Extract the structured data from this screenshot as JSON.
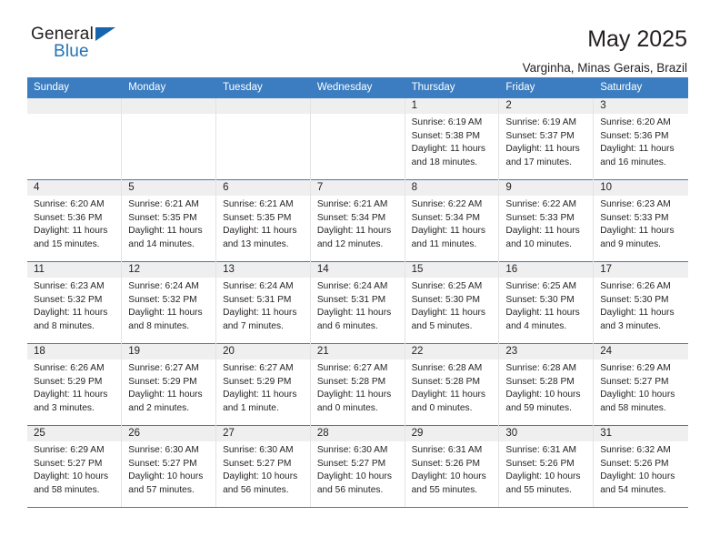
{
  "brand": {
    "name_top": "General",
    "name_bottom": "Blue",
    "triangle_icon": "blue-triangle-logo-mark",
    "color_dark": "#231f20",
    "color_blue": "#2272b8"
  },
  "header": {
    "title": "May 2025",
    "subtitle": "Varginha, Minas Gerais, Brazil"
  },
  "theme": {
    "header_row_bg": "#3b7dc0",
    "daynum_band_bg": "#efefef",
    "cell_bg": "#ffffff",
    "row_divider": "#3b7dc0",
    "text": "#231f20"
  },
  "calendar": {
    "weekday_headers": [
      "Sunday",
      "Monday",
      "Tuesday",
      "Wednesday",
      "Thursday",
      "Friday",
      "Saturday"
    ],
    "weeks": [
      [
        {
          "day": "",
          "empty": true
        },
        {
          "day": "",
          "empty": true
        },
        {
          "day": "",
          "empty": true
        },
        {
          "day": "",
          "empty": true
        },
        {
          "day": "1",
          "sunrise": "Sunrise: 6:19 AM",
          "sunset": "Sunset: 5:38 PM",
          "daylight": "Daylight: 11 hours and 18 minutes."
        },
        {
          "day": "2",
          "sunrise": "Sunrise: 6:19 AM",
          "sunset": "Sunset: 5:37 PM",
          "daylight": "Daylight: 11 hours and 17 minutes."
        },
        {
          "day": "3",
          "sunrise": "Sunrise: 6:20 AM",
          "sunset": "Sunset: 5:36 PM",
          "daylight": "Daylight: 11 hours and 16 minutes."
        }
      ],
      [
        {
          "day": "4",
          "sunrise": "Sunrise: 6:20 AM",
          "sunset": "Sunset: 5:36 PM",
          "daylight": "Daylight: 11 hours and 15 minutes."
        },
        {
          "day": "5",
          "sunrise": "Sunrise: 6:21 AM",
          "sunset": "Sunset: 5:35 PM",
          "daylight": "Daylight: 11 hours and 14 minutes."
        },
        {
          "day": "6",
          "sunrise": "Sunrise: 6:21 AM",
          "sunset": "Sunset: 5:35 PM",
          "daylight": "Daylight: 11 hours and 13 minutes."
        },
        {
          "day": "7",
          "sunrise": "Sunrise: 6:21 AM",
          "sunset": "Sunset: 5:34 PM",
          "daylight": "Daylight: 11 hours and 12 minutes."
        },
        {
          "day": "8",
          "sunrise": "Sunrise: 6:22 AM",
          "sunset": "Sunset: 5:34 PM",
          "daylight": "Daylight: 11 hours and 11 minutes."
        },
        {
          "day": "9",
          "sunrise": "Sunrise: 6:22 AM",
          "sunset": "Sunset: 5:33 PM",
          "daylight": "Daylight: 11 hours and 10 minutes."
        },
        {
          "day": "10",
          "sunrise": "Sunrise: 6:23 AM",
          "sunset": "Sunset: 5:33 PM",
          "daylight": "Daylight: 11 hours and 9 minutes."
        }
      ],
      [
        {
          "day": "11",
          "sunrise": "Sunrise: 6:23 AM",
          "sunset": "Sunset: 5:32 PM",
          "daylight": "Daylight: 11 hours and 8 minutes."
        },
        {
          "day": "12",
          "sunrise": "Sunrise: 6:24 AM",
          "sunset": "Sunset: 5:32 PM",
          "daylight": "Daylight: 11 hours and 8 minutes."
        },
        {
          "day": "13",
          "sunrise": "Sunrise: 6:24 AM",
          "sunset": "Sunset: 5:31 PM",
          "daylight": "Daylight: 11 hours and 7 minutes."
        },
        {
          "day": "14",
          "sunrise": "Sunrise: 6:24 AM",
          "sunset": "Sunset: 5:31 PM",
          "daylight": "Daylight: 11 hours and 6 minutes."
        },
        {
          "day": "15",
          "sunrise": "Sunrise: 6:25 AM",
          "sunset": "Sunset: 5:30 PM",
          "daylight": "Daylight: 11 hours and 5 minutes."
        },
        {
          "day": "16",
          "sunrise": "Sunrise: 6:25 AM",
          "sunset": "Sunset: 5:30 PM",
          "daylight": "Daylight: 11 hours and 4 minutes."
        },
        {
          "day": "17",
          "sunrise": "Sunrise: 6:26 AM",
          "sunset": "Sunset: 5:30 PM",
          "daylight": "Daylight: 11 hours and 3 minutes."
        }
      ],
      [
        {
          "day": "18",
          "sunrise": "Sunrise: 6:26 AM",
          "sunset": "Sunset: 5:29 PM",
          "daylight": "Daylight: 11 hours and 3 minutes."
        },
        {
          "day": "19",
          "sunrise": "Sunrise: 6:27 AM",
          "sunset": "Sunset: 5:29 PM",
          "daylight": "Daylight: 11 hours and 2 minutes."
        },
        {
          "day": "20",
          "sunrise": "Sunrise: 6:27 AM",
          "sunset": "Sunset: 5:29 PM",
          "daylight": "Daylight: 11 hours and 1 minute."
        },
        {
          "day": "21",
          "sunrise": "Sunrise: 6:27 AM",
          "sunset": "Sunset: 5:28 PM",
          "daylight": "Daylight: 11 hours and 0 minutes."
        },
        {
          "day": "22",
          "sunrise": "Sunrise: 6:28 AM",
          "sunset": "Sunset: 5:28 PM",
          "daylight": "Daylight: 11 hours and 0 minutes."
        },
        {
          "day": "23",
          "sunrise": "Sunrise: 6:28 AM",
          "sunset": "Sunset: 5:28 PM",
          "daylight": "Daylight: 10 hours and 59 minutes."
        },
        {
          "day": "24",
          "sunrise": "Sunrise: 6:29 AM",
          "sunset": "Sunset: 5:27 PM",
          "daylight": "Daylight: 10 hours and 58 minutes."
        }
      ],
      [
        {
          "day": "25",
          "sunrise": "Sunrise: 6:29 AM",
          "sunset": "Sunset: 5:27 PM",
          "daylight": "Daylight: 10 hours and 58 minutes."
        },
        {
          "day": "26",
          "sunrise": "Sunrise: 6:30 AM",
          "sunset": "Sunset: 5:27 PM",
          "daylight": "Daylight: 10 hours and 57 minutes."
        },
        {
          "day": "27",
          "sunrise": "Sunrise: 6:30 AM",
          "sunset": "Sunset: 5:27 PM",
          "daylight": "Daylight: 10 hours and 56 minutes."
        },
        {
          "day": "28",
          "sunrise": "Sunrise: 6:30 AM",
          "sunset": "Sunset: 5:27 PM",
          "daylight": "Daylight: 10 hours and 56 minutes."
        },
        {
          "day": "29",
          "sunrise": "Sunrise: 6:31 AM",
          "sunset": "Sunset: 5:26 PM",
          "daylight": "Daylight: 10 hours and 55 minutes."
        },
        {
          "day": "30",
          "sunrise": "Sunrise: 6:31 AM",
          "sunset": "Sunset: 5:26 PM",
          "daylight": "Daylight: 10 hours and 55 minutes."
        },
        {
          "day": "31",
          "sunrise": "Sunrise: 6:32 AM",
          "sunset": "Sunset: 5:26 PM",
          "daylight": "Daylight: 10 hours and 54 minutes."
        }
      ]
    ]
  }
}
